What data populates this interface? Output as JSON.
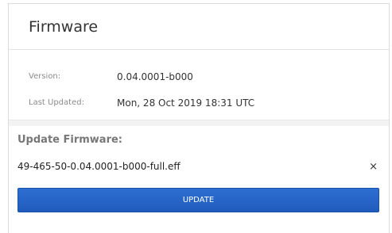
{
  "header": {
    "title": "Firmware"
  },
  "info": {
    "version_label": "Version:",
    "version_value": "0.04.0001-b000",
    "last_updated_label": "Last Updated:",
    "last_updated_value": "Mon, 28 Oct 2019 18:31 UTC"
  },
  "update": {
    "heading": "Update Firmware:",
    "file_name": "49-465-50-0.04.0001-b000-full.eff",
    "clear_icon": "×",
    "button_label": "UPDATE"
  },
  "colors": {
    "button": "#2163c6",
    "panel_border": "#dcdcdc"
  }
}
